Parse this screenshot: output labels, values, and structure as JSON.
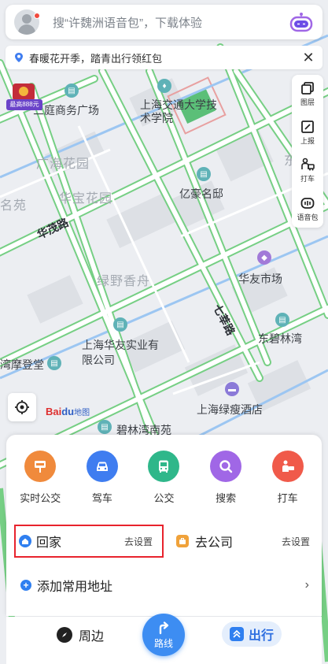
{
  "search": {
    "placeholder": "搜“许魏洲语音包”，下载体验"
  },
  "promo": {
    "text": "春暖花开季，踏青出行领红包"
  },
  "red_packet": {
    "tag": "最高888元"
  },
  "toolbar": {
    "items": [
      {
        "label": "图层",
        "icon": "layers-icon"
      },
      {
        "label": "上报",
        "icon": "report-icon"
      },
      {
        "label": "打车",
        "icon": "taxi-icon"
      },
      {
        "label": "语音包",
        "icon": "voice-pack-icon"
      }
    ]
  },
  "map": {
    "areas": [
      "三庭商务广场",
      "广海花园",
      "华宝花园",
      "绿野香舟",
      "名苑",
      "东"
    ],
    "pois": [
      "上海交通大学技术学院",
      "亿豪名邸",
      "华友市场",
      "上海华友实业有限公司",
      "东碧林湾",
      "上海绿瘦酒店",
      "碧林湾南苑",
      "湾摩登堂"
    ],
    "roads": [
      "华茂路",
      "七莘路"
    ],
    "logo": {
      "text_bai": "Bai",
      "text_du": "du",
      "text_map": "地图"
    }
  },
  "quick_actions": [
    {
      "label": "实时公交",
      "color": "#f08a3c",
      "icon": "bus-stop-icon"
    },
    {
      "label": "驾车",
      "color": "#3f7df0",
      "icon": "car-icon"
    },
    {
      "label": "公交",
      "color": "#2fb78a",
      "icon": "bus-icon"
    },
    {
      "label": "搜索",
      "color": "#a067e6",
      "icon": "search-icon"
    },
    {
      "label": "打车",
      "color": "#f05a4a",
      "icon": "taxi-icon"
    }
  ],
  "addresses": {
    "home": {
      "label": "回家",
      "action": "去设置"
    },
    "work": {
      "label": "去公司",
      "action": "去设置"
    },
    "add_label": "添加常用地址"
  },
  "bottom_nav": {
    "nearby": "周边",
    "route": "路线",
    "travel": "出行"
  }
}
